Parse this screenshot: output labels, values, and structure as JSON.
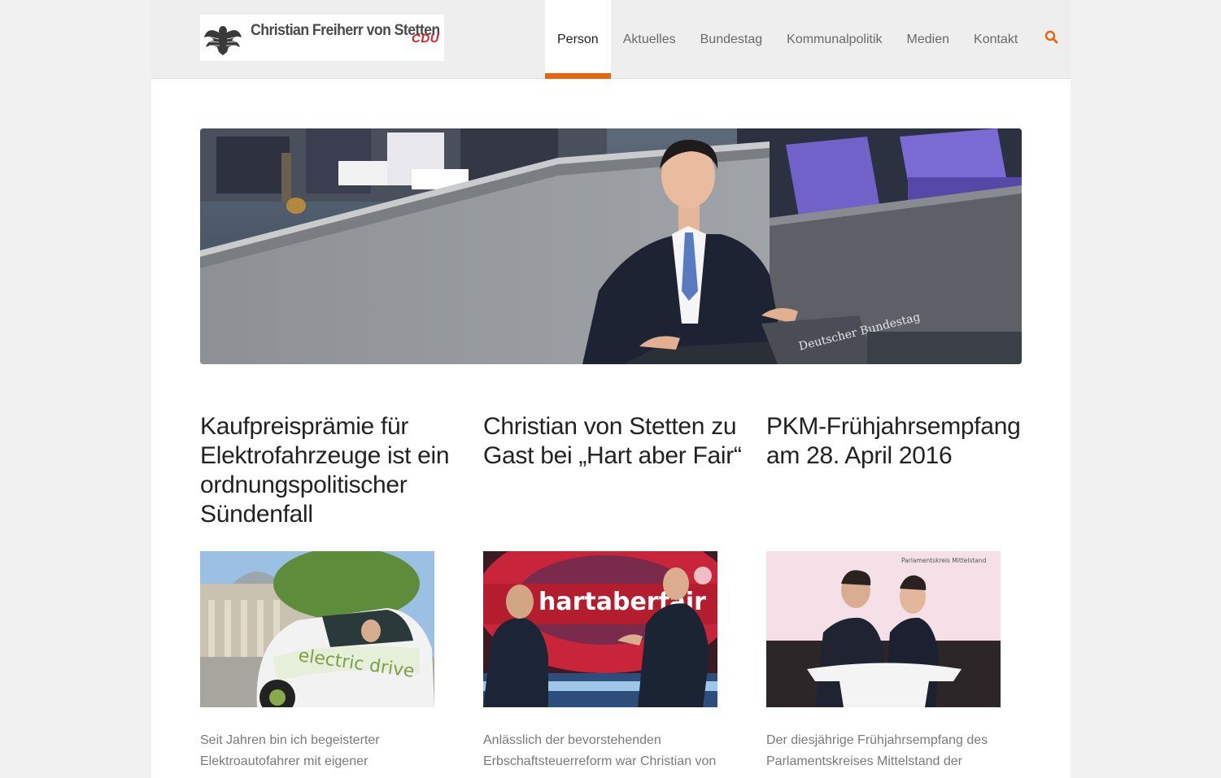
{
  "header": {
    "logo_name": "Christian Freiherr von Stetten",
    "logo_party": "CDU",
    "nav": [
      {
        "label": "Person",
        "active": true
      },
      {
        "label": "Aktuelles",
        "active": false
      },
      {
        "label": "Bundestag",
        "active": false
      },
      {
        "label": "Kommunalpolitik",
        "active": false
      },
      {
        "label": "Medien",
        "active": false
      },
      {
        "label": "Kontakt",
        "active": false
      }
    ],
    "search_icon": "search-icon",
    "accent_color": "#e8650f"
  },
  "hero": {
    "podium_text": "Deutscher Bundestag"
  },
  "articles": [
    {
      "title": "Kaufpreisprämie für Elektrofahrzeuge ist ein ordnungspolitischer Sündenfall",
      "image_text": "electric drive",
      "excerpt": "Seit Jahren bin ich begeisterter Elektroautofahrer mit eigener"
    },
    {
      "title": "Christian von Stetten zu Gast bei „Hart aber Fair“",
      "image_text": "hartaberfair",
      "excerpt": "Anlässlich der bevorstehenden Erbschaftsteuerreform war Christian von"
    },
    {
      "title": "PKM-Frühjahrsempfang am 28. April 2016",
      "image_text": "Parlamentskreis Mittelstand",
      "excerpt": "Der diesjährige Frühjahrsempfang des Parlamentskreises Mittelstand der"
    }
  ]
}
